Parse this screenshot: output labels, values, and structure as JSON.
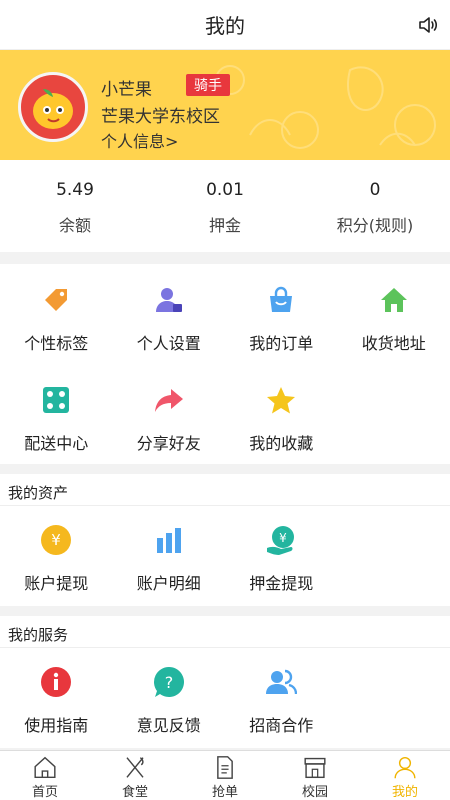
{
  "header": {
    "title": "我的"
  },
  "profile": {
    "name": "小芒果",
    "role_badge": "骑手",
    "school": "芒果大学东校区",
    "info_link": "个人信息>"
  },
  "stats": [
    {
      "value": "5.49",
      "label": "余额"
    },
    {
      "value": "0.01",
      "label": "押金"
    },
    {
      "value": "0",
      "label": "积分(规则)"
    }
  ],
  "menu": [
    {
      "label": "个性标签",
      "icon": "tag-icon",
      "color": "#f39a33"
    },
    {
      "label": "个人设置",
      "icon": "user-settings-icon",
      "color": "#7b74e0"
    },
    {
      "label": "我的订单",
      "icon": "shopping-bag-icon",
      "color": "#4ea3ef"
    },
    {
      "label": "收货地址",
      "icon": "home-icon",
      "color": "#5cc35b"
    },
    {
      "label": "配送中心",
      "icon": "delivery-center-icon",
      "color": "#23b59f"
    },
    {
      "label": "分享好友",
      "icon": "share-icon",
      "color": "#f0566a"
    },
    {
      "label": "我的收藏",
      "icon": "star-icon",
      "color": "#f5c51c"
    }
  ],
  "assets": {
    "title": "我的资产",
    "items": [
      {
        "label": "账户提现",
        "icon": "yen-coin-icon",
        "color": "#f5b81e"
      },
      {
        "label": "账户明细",
        "icon": "bar-chart-icon",
        "color": "#4ea3ef"
      },
      {
        "label": "押金提现",
        "icon": "deposit-withdraw-icon",
        "color": "#23b59f"
      }
    ]
  },
  "services": {
    "title": "我的服务",
    "items": [
      {
        "label": "使用指南",
        "icon": "info-icon",
        "color": "#e8373d"
      },
      {
        "label": "意见反馈",
        "icon": "feedback-icon",
        "color": "#23b59f"
      },
      {
        "label": "招商合作",
        "icon": "partner-icon",
        "color": "#4ea3ef"
      }
    ]
  },
  "tabbar": [
    {
      "label": "首页",
      "icon": "home-outline-icon"
    },
    {
      "label": "食堂",
      "icon": "utensils-icon"
    },
    {
      "label": "抢单",
      "icon": "document-icon"
    },
    {
      "label": "校园",
      "icon": "store-icon"
    },
    {
      "label": "我的",
      "icon": "person-icon",
      "active": true
    }
  ],
  "colors": {
    "accent": "#ffd34e",
    "active_tab": "#f0b400",
    "badge": "#e8373d"
  }
}
